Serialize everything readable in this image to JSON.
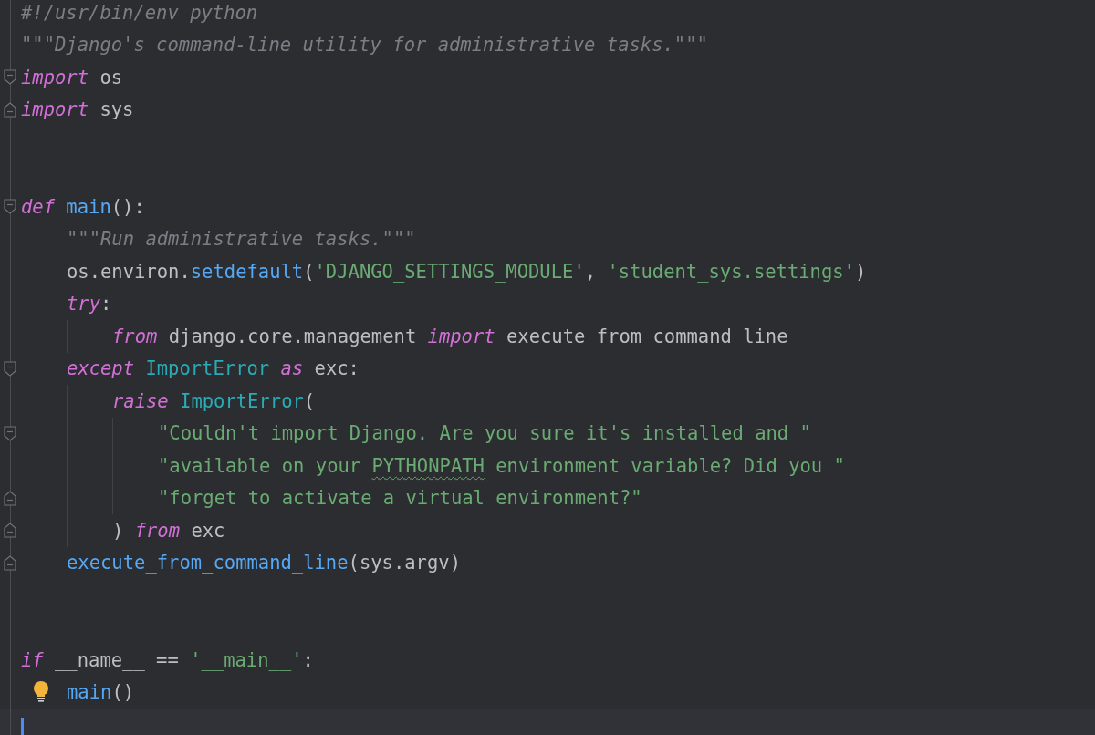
{
  "editor": {
    "lines": [
      {
        "kind": "code",
        "tokens": [
          {
            "text": "#!/usr/bin/env python",
            "kind": "comment"
          }
        ]
      },
      {
        "kind": "code",
        "tokens": [
          {
            "text": "\"\"\"Django's command-line utility for administrative tasks.\"\"\"",
            "kind": "doc"
          }
        ]
      },
      {
        "kind": "code",
        "fold_start": true,
        "tokens": [
          {
            "text": "import",
            "kind": "keyword"
          },
          {
            "text": " os",
            "kind": "plain"
          }
        ]
      },
      {
        "kind": "code",
        "fold_end": true,
        "tokens": [
          {
            "text": "import",
            "kind": "keyword"
          },
          {
            "text": " sys",
            "kind": "plain"
          }
        ]
      },
      {
        "kind": "blank"
      },
      {
        "kind": "blank"
      },
      {
        "kind": "code",
        "fold_start": true,
        "tokens": [
          {
            "text": "def",
            "kind": "keyword"
          },
          {
            "text": " main",
            "kind": "func"
          },
          {
            "text": "():",
            "kind": "plain"
          }
        ],
        "children": [
          {
            "kind": "code",
            "tokens": [
              {
                "text": "\"\"\"Run administrative tasks.\"\"\"",
                "kind": "doc"
              }
            ]
          },
          {
            "kind": "code",
            "tokens": [
              {
                "text": "os.environ.",
                "kind": "plain"
              },
              {
                "text": "setdefault",
                "kind": "func"
              },
              {
                "text": "(",
                "kind": "plain"
              },
              {
                "text": "'DJANGO_SETTINGS_MODULE'",
                "kind": "string"
              },
              {
                "text": ", ",
                "kind": "plain"
              },
              {
                "text": "'student_sys.settings'",
                "kind": "string"
              },
              {
                "text": ")",
                "kind": "plain"
              }
            ]
          },
          {
            "kind": "code",
            "tokens": [
              {
                "text": "try",
                "kind": "keyword"
              },
              {
                "text": ":",
                "kind": "plain"
              }
            ],
            "children": [
              {
                "kind": "code",
                "tokens": [
                  {
                    "text": "from",
                    "kind": "keyword"
                  },
                  {
                    "text": " django.core.management ",
                    "kind": "plain"
                  },
                  {
                    "text": "import",
                    "kind": "keyword"
                  },
                  {
                    "text": " execute_from_command_line",
                    "kind": "plain"
                  }
                ]
              }
            ]
          },
          {
            "kind": "code",
            "fold_start": true,
            "tokens": [
              {
                "text": "except",
                "kind": "keyword"
              },
              {
                "text": " ImportError",
                "kind": "class"
              },
              {
                "text": " as",
                "kind": "keyword"
              },
              {
                "text": " exc:",
                "kind": "plain"
              }
            ],
            "children": [
              {
                "kind": "code",
                "tokens": [
                  {
                    "text": "raise",
                    "kind": "keyword"
                  },
                  {
                    "text": " ImportError",
                    "kind": "class"
                  },
                  {
                    "text": "(",
                    "kind": "plain"
                  }
                ],
                "children": [
                  {
                    "kind": "code",
                    "fold_start": true,
                    "tokens": [
                      {
                        "text": "\"Couldn't import Django. Are you sure it's installed and \"",
                        "kind": "string"
                      }
                    ]
                  },
                  {
                    "kind": "code",
                    "tokens": [
                      {
                        "text": "\"available on your ",
                        "kind": "string"
                      },
                      {
                        "text": "PYTHONPATH",
                        "kind": "typo"
                      },
                      {
                        "text": " environment variable? Did you \"",
                        "kind": "string"
                      }
                    ]
                  },
                  {
                    "kind": "code",
                    "fold_end": true,
                    "tokens": [
                      {
                        "text": "\"forget to activate a virtual environment?\"",
                        "kind": "string"
                      }
                    ]
                  }
                ]
              },
              {
                "kind": "code",
                "fold_end": true,
                "tokens": [
                  {
                    "text": ") ",
                    "kind": "plain"
                  },
                  {
                    "text": "from",
                    "kind": "keyword"
                  },
                  {
                    "text": " exc",
                    "kind": "plain"
                  }
                ]
              }
            ]
          },
          {
            "kind": "code",
            "fold_end": true,
            "tokens": [
              {
                "text": "execute_from_command_line",
                "kind": "func"
              },
              {
                "text": "(sys.argv)",
                "kind": "plain"
              }
            ]
          }
        ]
      },
      {
        "kind": "blank"
      },
      {
        "kind": "blank"
      },
      {
        "kind": "code",
        "tokens": [
          {
            "text": "if",
            "kind": "keyword"
          },
          {
            "text": " __name__ == ",
            "kind": "plain"
          },
          {
            "text": "'__main__'",
            "kind": "string"
          },
          {
            "text": ":",
            "kind": "plain"
          }
        ],
        "children": [
          {
            "kind": "code",
            "hint": true,
            "tokens": [
              {
                "text": "main",
                "kind": "func"
              },
              {
                "text": "()",
                "kind": "plain"
              }
            ]
          }
        ]
      },
      {
        "kind": "caret"
      }
    ]
  }
}
